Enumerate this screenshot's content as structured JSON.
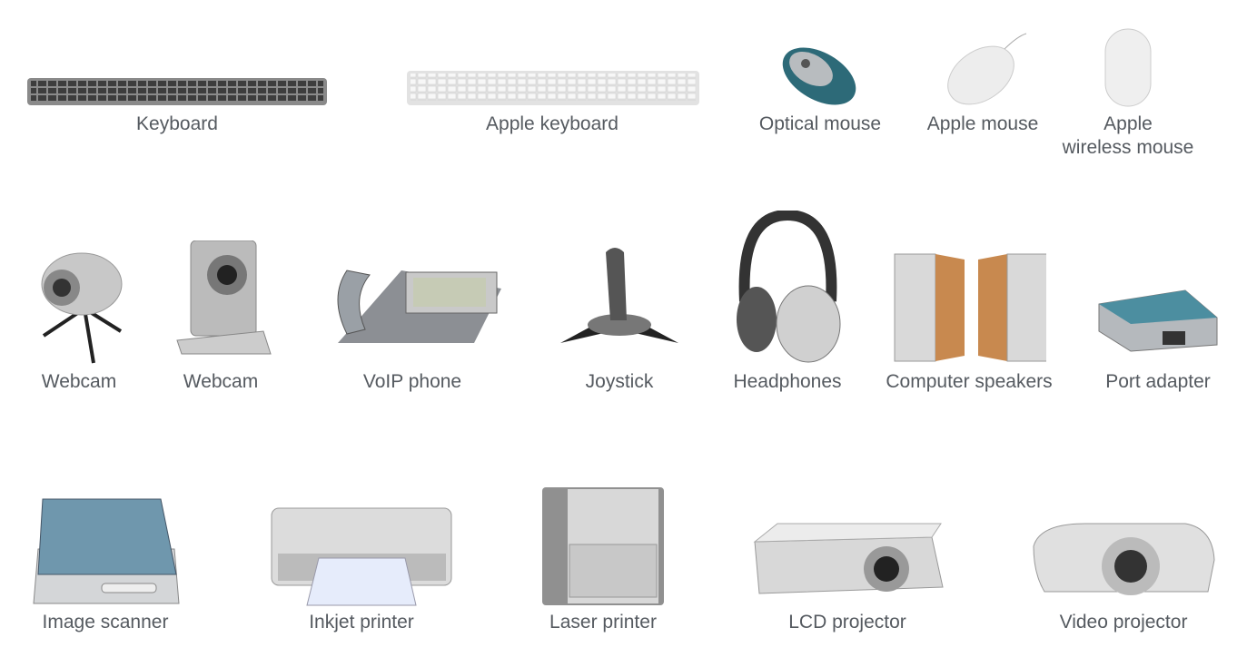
{
  "items": [
    {
      "id": "keyboard",
      "label": "Keyboard"
    },
    {
      "id": "apple-keyboard",
      "label": "Apple keyboard"
    },
    {
      "id": "optical-mouse",
      "label": "Optical mouse"
    },
    {
      "id": "apple-mouse",
      "label": "Apple mouse"
    },
    {
      "id": "apple-wireless-mouse",
      "label": "Apple wireless mouse",
      "line1": "Apple",
      "line2": "wireless mouse"
    },
    {
      "id": "webcam-1",
      "label": "Webcam"
    },
    {
      "id": "webcam-2",
      "label": "Webcam"
    },
    {
      "id": "voip-phone",
      "label": "VoIP phone"
    },
    {
      "id": "joystick",
      "label": "Joystick"
    },
    {
      "id": "headphones",
      "label": "Headphones"
    },
    {
      "id": "computer-speakers",
      "label": "Computer speakers"
    },
    {
      "id": "port-adapter",
      "label": "Port adapter"
    },
    {
      "id": "image-scanner",
      "label": "Image scanner"
    },
    {
      "id": "inkjet-printer",
      "label": "Inkjet printer"
    },
    {
      "id": "laser-printer",
      "label": "Laser printer"
    },
    {
      "id": "lcd-projector",
      "label": "LCD projector"
    },
    {
      "id": "video-projector",
      "label": "Video projector"
    }
  ],
  "colors": {
    "label": "#555a60",
    "scanner_lid": "#6f97ad",
    "speaker_side": "#c8894f",
    "mouse_teal": "#2d6a78"
  }
}
